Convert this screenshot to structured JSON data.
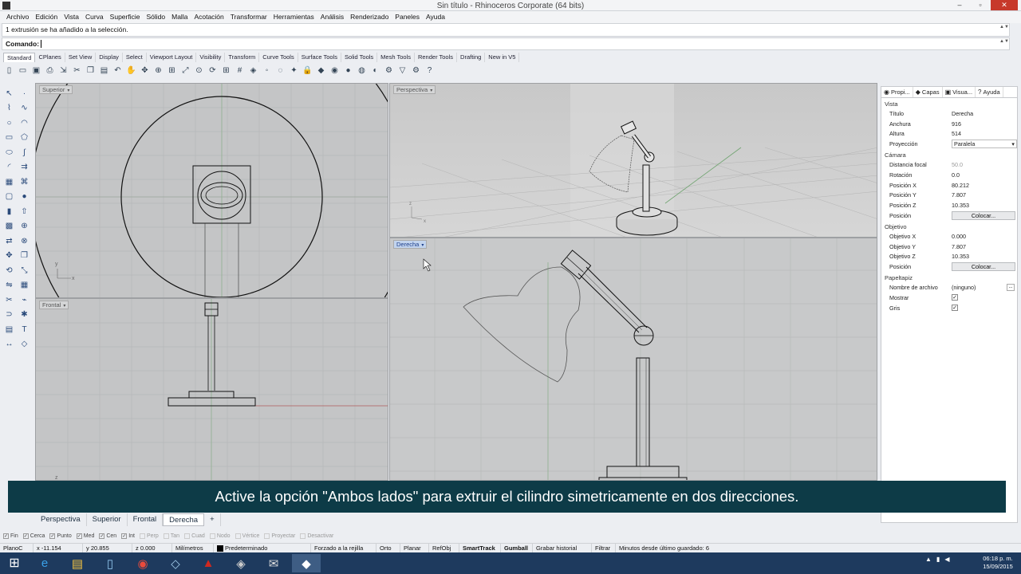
{
  "window": {
    "title": "Sin título - Rhinoceros Corporate (64 bits)",
    "minimize": "–",
    "maximize": "▫",
    "close": "✕"
  },
  "menu": [
    "Archivo",
    "Edición",
    "Vista",
    "Curva",
    "Superficie",
    "Sólido",
    "Malla",
    "Acotación",
    "Transformar",
    "Herramientas",
    "Análisis",
    "Renderizado",
    "Paneles",
    "Ayuda"
  ],
  "history": {
    "text": "1 extrusión se ha añadido a la selección."
  },
  "command": {
    "label": "Comando:",
    "value": ""
  },
  "toolbar_tabs": [
    "Standard",
    "CPlanes",
    "Set View",
    "Display",
    "Select",
    "Viewport Layout",
    "Visibility",
    "Transform",
    "Curve Tools",
    "Surface Tools",
    "Solid Tools",
    "Mesh Tools",
    "Render Tools",
    "Drafting",
    "New in V5"
  ],
  "toolbar_icons": [
    "new-icon",
    "open-icon",
    "save-icon",
    "print-icon",
    "import-icon",
    "cut-icon",
    "copy-icon",
    "paste-icon",
    "undo-icon",
    "pan-icon",
    "move-icon",
    "zoom-icon",
    "zoom-window-icon",
    "zoom-extents-icon",
    "zoom-selected-icon",
    "rotate-view-icon",
    "four-view-icon",
    "grid-icon",
    "layer-icon",
    "select-point-icon",
    "hide-icon",
    "light-icon",
    "lock-icon",
    "material-icon",
    "color-wheel-icon",
    "render-icon",
    "sphere-display-icon",
    "shaded-icon",
    "options-icon",
    "filter-icon",
    "gear-icon",
    "help-icon"
  ],
  "left_tools": [
    "select-arrow-icon",
    "point-icon",
    "polyline-icon",
    "curve-icon",
    "circle-icon",
    "arc-icon",
    "rectangle-icon",
    "polygon-icon",
    "ellipse-icon",
    "freeform-icon",
    "fillet-icon",
    "offset-icon",
    "surface-icon",
    "loft-icon",
    "box-icon",
    "sphere-icon",
    "cylinder-icon",
    "extrude-icon",
    "mesh-icon",
    "boolean-icon",
    "transform-icon",
    "gumball-icon",
    "move-icon",
    "copy-tool-icon",
    "rotate-icon",
    "scale-icon",
    "mirror-icon",
    "array-icon",
    "split-icon",
    "trim-icon",
    "join-icon",
    "explode-icon",
    "group-icon",
    "text-icon",
    "dimension-icon",
    "analyze-icon"
  ],
  "viewports": {
    "superior": {
      "label": "Superior"
    },
    "perspectiva": {
      "label": "Perspectiva"
    },
    "frontal": {
      "label": "Frontal"
    },
    "derecha": {
      "label": "Derecha"
    }
  },
  "panel": {
    "tabs": [
      {
        "icon": "properties-icon",
        "label": "Propi..."
      },
      {
        "icon": "layers-icon",
        "label": "Capas"
      },
      {
        "icon": "display-icon",
        "label": "Visua..."
      },
      {
        "icon": "help-icon",
        "label": "Ayuda"
      }
    ],
    "sections": {
      "vista": "Vista",
      "camara": "Cámara",
      "objetivo": "Objetivo",
      "papeltapiz": "Papeltapiz"
    },
    "vista_rows": [
      {
        "k": "Título",
        "v": "Derecha"
      },
      {
        "k": "Anchura",
        "v": "916"
      },
      {
        "k": "Altura",
        "v": "514"
      },
      {
        "k": "Proyección",
        "v": "Paralela",
        "dropdown": true
      }
    ],
    "camara_rows": [
      {
        "k": "Distancia focal",
        "v": "50.0",
        "dim": true
      },
      {
        "k": "Rotación",
        "v": "0.0"
      },
      {
        "k": "Posición X",
        "v": "80.212"
      },
      {
        "k": "Posición Y",
        "v": "7.807"
      },
      {
        "k": "Posición Z",
        "v": "10.353"
      },
      {
        "k": "Posición",
        "button": "Colocar..."
      }
    ],
    "objetivo_rows": [
      {
        "k": "Objetivo X",
        "v": "0.000"
      },
      {
        "k": "Objetivo Y",
        "v": "7.807"
      },
      {
        "k": "Objetivo Z",
        "v": "10.353"
      },
      {
        "k": "Posición",
        "button": "Colocar..."
      }
    ],
    "papeltapiz_rows": [
      {
        "k": "Nombre de archivo",
        "v": "(ninguno)",
        "dots": "..."
      },
      {
        "k": "Mostrar",
        "check": "✓"
      },
      {
        "k": "Gris",
        "check": "✓"
      }
    ]
  },
  "caption": "Active la opción \"Ambos lados\" para extruir el cilindro simetricamente en dos direcciones.",
  "view_tabs": [
    "Perspectiva",
    "Superior",
    "Frontal",
    "Derecha",
    "+"
  ],
  "osnaps": [
    {
      "label": "Fin",
      "on": true
    },
    {
      "label": "Cerca",
      "on": true
    },
    {
      "label": "Punto",
      "on": true
    },
    {
      "label": "Med",
      "on": true
    },
    {
      "label": "Cen",
      "on": true
    },
    {
      "label": "Int",
      "on": true
    },
    {
      "label": "Perp",
      "on": false
    },
    {
      "label": "Tan",
      "on": false
    },
    {
      "label": "Cuad",
      "on": false
    },
    {
      "label": "Nodo",
      "on": false
    },
    {
      "label": "Vértice",
      "on": false
    },
    {
      "label": "Proyectar",
      "on": false
    },
    {
      "label": "Desactivar",
      "on": false
    }
  ],
  "status": {
    "cplane": "PlanoC",
    "x": "x -11.154",
    "y": "y 20.855",
    "z": "z 0.000",
    "units": "Milímetros",
    "layer": "Predeterminado",
    "grid_snap": "Forzado a la rejilla",
    "ortho": "Orto",
    "planar": "Planar",
    "osnap": "RefObj",
    "smarttrack": "SmartTrack",
    "gumball": "Gumball",
    "record": "Grabar historial",
    "filter": "Filtrar",
    "saved": "Minutos desde último guardado: 6"
  },
  "taskbar": {
    "apps": [
      "explorer-ie-icon",
      "file-explorer-icon",
      "notepad-icon",
      "chrome-icon",
      "rhino-icon",
      "acrobat-icon",
      "toolbox-icon",
      "mail-icon",
      "rhino-active-icon"
    ],
    "time": "06:18 p. m.",
    "date": "15/09/2015"
  }
}
